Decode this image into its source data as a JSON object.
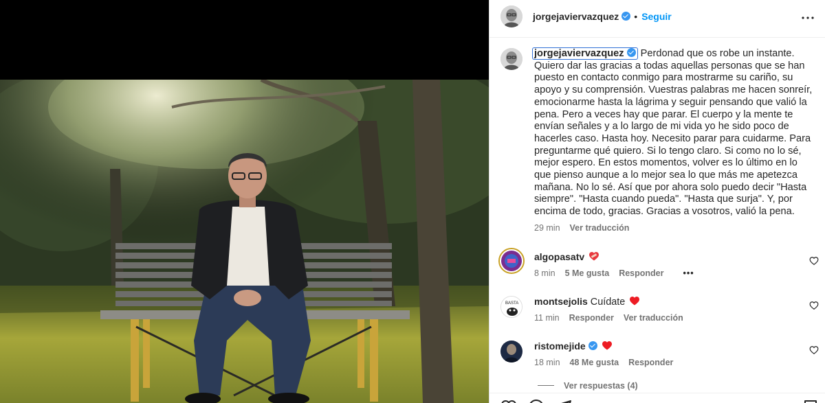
{
  "post": {
    "username": "jorgejaviervazquez",
    "separator": "•",
    "follow_label": "Seguir",
    "caption": "Perdonad que os robe un instante. Quiero dar las gracias a todas aquellas personas que se han puesto en contacto conmigo para mostrarme su cariño, su apoyo y su comprensión. Vuestras palabras me hacen sonreír, emocionarme hasta la lágrima y seguir pensando que valió la pena. Pero a veces hay que parar. El cuerpo y la mente te envían señales y a lo largo de mi vida yo he sido poco de hacerles caso. Hasta hoy. Necesito parar para cuidarme. Para preguntarme qué quiero. Si lo tengo claro. Si como no lo sé, mejor espero. En estos momentos, volver es lo último en lo que pienso aunque a lo mejor sea lo que más me apetezca mañana. No lo sé. Así que por ahora solo puedo decir \"Hasta siempre\". \"Hasta cuando pueda\". \"Hasta que surja\". Y, por encima de todo, gracias. Gracias a vosotros, valió la pena.",
    "time": "29 min",
    "translate_label": "Ver traducción"
  },
  "comments": [
    {
      "username": "algopasatv",
      "text": "",
      "emoji": "heart-with-bandage",
      "time": "8 min",
      "likes": "5 Me gusta",
      "reply_label": "Responder",
      "more": "•••"
    },
    {
      "username": "montsejolis",
      "text": "Cuídate",
      "emoji": "red-heart",
      "time": "11 min",
      "reply_label": "Responder",
      "translate_label": "Ver traducción"
    },
    {
      "username": "ristomejide",
      "text": "",
      "emoji": "red-heart",
      "verified": true,
      "time": "18 min",
      "likes": "48 Me gusta",
      "reply_label": "Responder"
    }
  ],
  "replies_label": "Ver respuestas (4)",
  "colors": {
    "accent": "#0095f6",
    "verified": "#3897f0",
    "heart": "#ed1c24"
  }
}
